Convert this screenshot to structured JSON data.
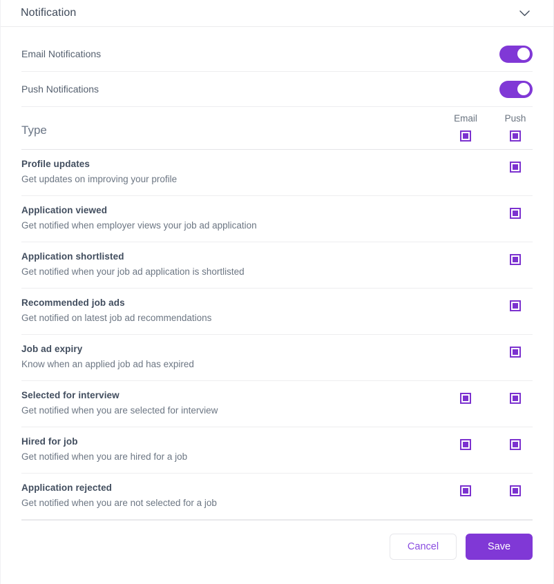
{
  "accordion": {
    "title": "Notification",
    "collapse_icon": "chevron-down-icon"
  },
  "master_toggles": [
    {
      "label": "Email Notifications",
      "enabled": true
    },
    {
      "label": "Push Notifications",
      "enabled": true
    }
  ],
  "table": {
    "type_header": "Type",
    "columns": [
      {
        "key": "email",
        "label": "Email",
        "select_all_checked": true
      },
      {
        "key": "push",
        "label": "Push",
        "select_all_checked": true
      }
    ],
    "rows": [
      {
        "title": "Profile updates",
        "description": "Get updates on improving your profile",
        "email": false,
        "push": true
      },
      {
        "title": "Application viewed",
        "description": "Get notified when employer views your job ad application",
        "email": false,
        "push": true
      },
      {
        "title": "Application shortlisted",
        "description": "Get notified when your job ad application is shortlisted",
        "email": false,
        "push": true
      },
      {
        "title": "Recommended job ads",
        "description": "Get notified on latest job ad recommendations",
        "email": false,
        "push": true
      },
      {
        "title": "Job ad expiry",
        "description": "Know when an applied job ad has expired",
        "email": false,
        "push": true
      },
      {
        "title": "Selected for interview",
        "description": "Get notified when you are selected for interview",
        "email": true,
        "push": true
      },
      {
        "title": "Hired for job",
        "description": "Get notified when you are hired for a job",
        "email": true,
        "push": true
      },
      {
        "title": "Application rejected",
        "description": "Get notified when you are not selected for a job",
        "email": true,
        "push": true
      }
    ]
  },
  "footer": {
    "cancel_label": "Cancel",
    "save_label": "Save"
  },
  "colors": {
    "accent_purple": "#8038d6",
    "checkbox_purple": "#7c32cf",
    "cancel_text": "#8a4de0",
    "title_text": "#3f4a5a",
    "body_text": "#6c7683",
    "divider": "#ededef"
  }
}
